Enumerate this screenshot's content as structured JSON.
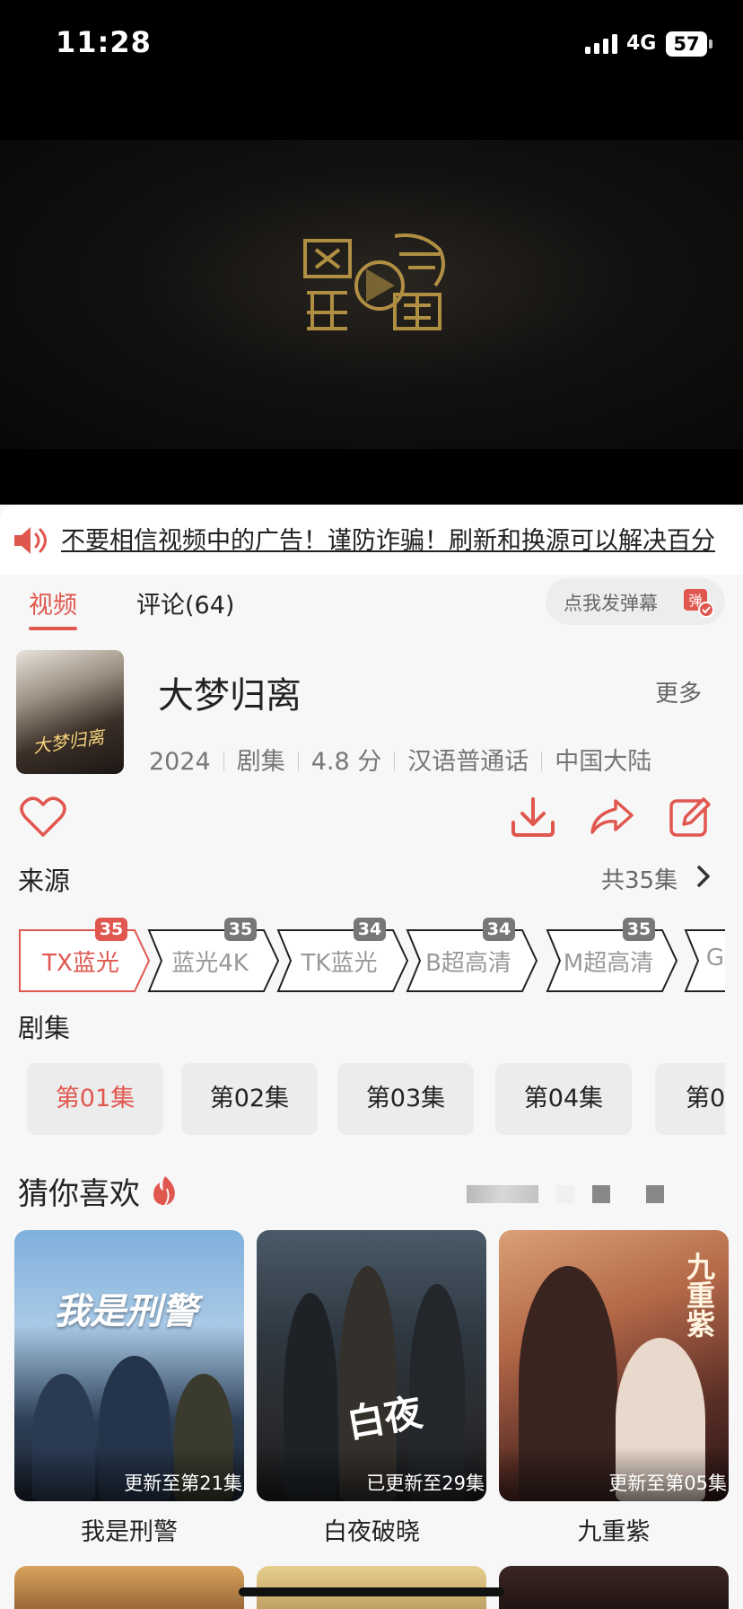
{
  "status_bar": {
    "time": "11:28",
    "network": "4G",
    "battery": "57"
  },
  "player": {
    "logo_icon": "studio-logo"
  },
  "notice": {
    "icon": "speaker-icon",
    "text": "不要相信视频中的广告！谨防诈骗！刷新和换源可以解决百分"
  },
  "tabs": [
    {
      "label": "视频",
      "active": true
    },
    {
      "label": "评论(64)",
      "active": false
    }
  ],
  "danmaku": {
    "label": "点我发弹幕",
    "icon": "danmaku-icon"
  },
  "show": {
    "title": "大梦归离",
    "poster_text": "大梦归离",
    "more_label": "更多",
    "meta": [
      "2024",
      "剧集",
      "4.8 分",
      "汉语普通话",
      "中国大陆"
    ]
  },
  "actions": {
    "favorite": "heart-icon",
    "download": "download-icon",
    "share": "share-icon",
    "edit": "edit-icon"
  },
  "source_section": {
    "title": "来源",
    "count": "共35集",
    "items": [
      {
        "label": "TX蓝光",
        "badge": "35",
        "active": true
      },
      {
        "label": "蓝光4K",
        "badge": "35",
        "active": false
      },
      {
        "label": "TK蓝光",
        "badge": "34",
        "active": false
      },
      {
        "label": "B超高清",
        "badge": "34",
        "active": false
      },
      {
        "label": "M超高清",
        "badge": "35",
        "active": false
      },
      {
        "label": "G",
        "badge": "",
        "active": false
      }
    ]
  },
  "episode_section": {
    "title": "剧集",
    "items": [
      {
        "label": "第01集",
        "active": true
      },
      {
        "label": "第02集",
        "active": false
      },
      {
        "label": "第03集",
        "active": false
      },
      {
        "label": "第04集",
        "active": false
      },
      {
        "label": "第0",
        "active": false
      }
    ]
  },
  "recommend": {
    "title": "猜你喜欢",
    "items": [
      {
        "title": "我是刑警",
        "update": "更新至第21集",
        "poster_text": "我是刑警"
      },
      {
        "title": "白夜破晓",
        "update": "已更新至29集",
        "poster_text": "白夜"
      },
      {
        "title": "九重紫",
        "update": "更新至第05集",
        "poster_text": "九重紫"
      }
    ]
  },
  "colors": {
    "accent": "#e0574f",
    "background": "#f7f7f7",
    "status_bar": "#000000"
  }
}
